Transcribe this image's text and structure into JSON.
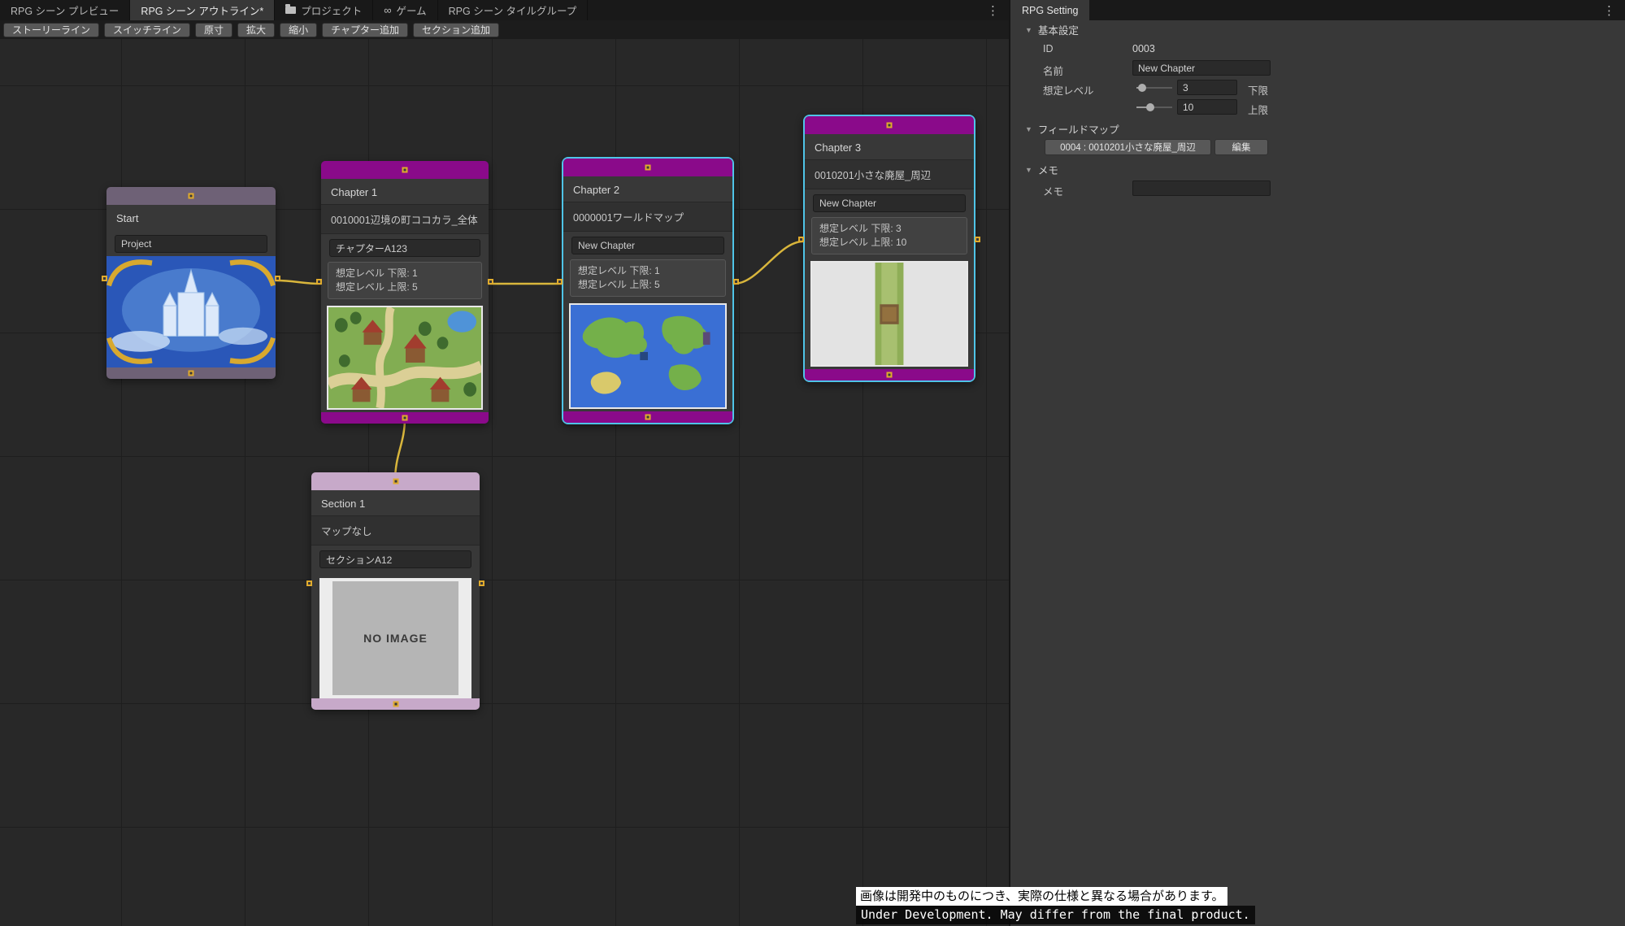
{
  "colors": {
    "selection": "#4fc4e7",
    "edge": "#d9b63c",
    "chapter_header": "#8a0a8a",
    "start_header": "#6e6176",
    "section_header": "#c7a9c9"
  },
  "icons": {
    "kebab": "⋮",
    "foldout": "▼",
    "game": "∞"
  },
  "tabbar": {
    "tabs": [
      {
        "label": "RPG シーン プレビュー"
      },
      {
        "label": "RPG シーン アウトライン*"
      },
      {
        "label": "プロジェクト"
      },
      {
        "label": "ゲーム"
      },
      {
        "label": "RPG シーン タイルグループ"
      }
    ]
  },
  "toolbar": {
    "buttons": [
      "ストーリーライン",
      "スイッチライン",
      "原寸",
      "拡大",
      "縮小",
      "チャプター追加",
      "セクション追加"
    ]
  },
  "graph": {
    "start": {
      "title": "Start",
      "project": "Project"
    },
    "chapter1": {
      "title": "Chapter 1",
      "map": "0010001辺境の町ココカラ_全体",
      "name": "チャプターA123",
      "level_min": "想定レベル 下限: 1",
      "level_max": "想定レベル 上限: 5"
    },
    "chapter2": {
      "title": "Chapter 2",
      "map": "0000001ワールドマップ",
      "name": "New Chapter",
      "level_min": "想定レベル 下限: 1",
      "level_max": "想定レベル 上限: 5"
    },
    "chapter3": {
      "title": "Chapter 3",
      "map": "0010201小さな廃屋_周辺",
      "name": "New Chapter",
      "level_min": "想定レベル 下限: 3",
      "level_max": "想定レベル 上限: 10"
    },
    "section1": {
      "title": "Section 1",
      "map": "マップなし",
      "name": "セクションA12",
      "no_image": "NO IMAGE"
    }
  },
  "inspector": {
    "tab": "RPG Setting",
    "basic": {
      "label": "基本設定",
      "id_label": "ID",
      "id_value": "0003",
      "name_label": "名前",
      "name_value": "New Chapter",
      "level_label": "想定レベル",
      "min_value": "3",
      "min_suffix": "下限",
      "max_value": "10",
      "max_suffix": "上限"
    },
    "fieldmap": {
      "label": "フィールドマップ",
      "map_button": "0004 : 0010201小さな廃屋_周辺",
      "edit_button": "編集"
    },
    "memo": {
      "label": "メモ",
      "field_label": "メモ",
      "value": ""
    }
  },
  "disclaimer": {
    "jp": "画像は開発中のものにつき、実際の仕様と異なる場合があります。",
    "en": "Under Development. May differ from the final product."
  }
}
